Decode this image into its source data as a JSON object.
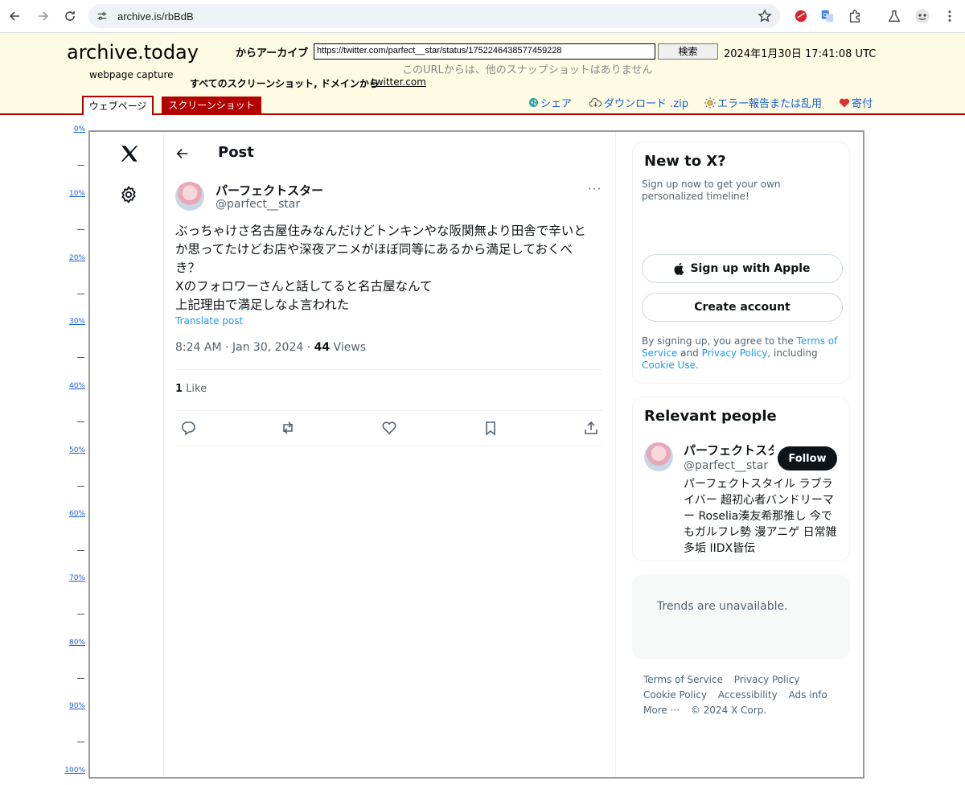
{
  "browser": {
    "url": "archive.is/rbBdB"
  },
  "archive": {
    "logo": "archive.today",
    "sublogo": "webpage capture",
    "from_label": "からアーカイブ",
    "url_value": "https://twitter.com/parfect__star/status/1752246438577459228",
    "search_label": "検索",
    "date": "2024年1月30日 17:41:08 UTC",
    "no_snapshots": "このURLからは、他のスナップショットはありません",
    "all_screenshots": "すべてのスクリーンショット, ドメインから",
    "domain_link": "twitter.com",
    "tab_webpage": "ウェブページ",
    "tab_screenshot": "スクリーンショット",
    "share": "シェア",
    "download": "ダウンロード .zip",
    "report": "エラー報告または乱用",
    "donate": "寄付"
  },
  "ruler": [
    "0%",
    "10%",
    "20%",
    "30%",
    "40%",
    "50%",
    "60%",
    "70%",
    "80%",
    "90%",
    "100%"
  ],
  "post": {
    "header_title": "Post",
    "display_name": "パーフェクトスター",
    "handle": "@parfect__star",
    "more": "···",
    "text_lines": [
      "ぶっちゃけさ名古屋住みなんだけどトンキンやな阪関無より田舎で辛いと",
      "か思ってたけどお店や深夜アニメがほぼ同等にあるから満足しておくべ",
      "き？",
      "Xのフォロワーさんと話してると名古屋なんて",
      "上記理由で満足しなよ言われた"
    ],
    "translate": "Translate post",
    "time": "8:24 AM · Jan 30, 2024 · ",
    "views_count": "44",
    "views_label": " Views",
    "likes_count": "1",
    "likes_label": " Like"
  },
  "sidebar": {
    "new_title": "New to X?",
    "new_sub": "Sign up now to get your own personalized timeline!",
    "apple_label": "Sign up with Apple",
    "create_label": "Create account",
    "terms_1": "By signing up, you agree to the ",
    "terms_link_1": "Terms of Service",
    "terms_2": " and ",
    "terms_link_2": "Privacy Policy",
    "terms_3": ", including ",
    "terms_link_3": "Cookie Use",
    "terms_4": ".",
    "relevant_title": "Relevant people",
    "person_name": "パーフェクトス⁠タ",
    "person_handle": "@parfect__star",
    "follow_label": "Follow",
    "bio": "パーフェクトスタイル ラブライバー 超初心者バンドリーマー Roselia湊友希那推し 今でもガルフレ勢 漫アニゲ 日常雑多垢 IIDX皆伝",
    "trends_text": "Trends are unavailable.",
    "footer": {
      "tos": "Terms of Service",
      "privacy": "Privacy Policy",
      "cookie": "Cookie Policy",
      "access": "Accessibility",
      "ads": "Ads info",
      "more": "More ···",
      "copyright": "© 2024 X Corp."
    }
  }
}
